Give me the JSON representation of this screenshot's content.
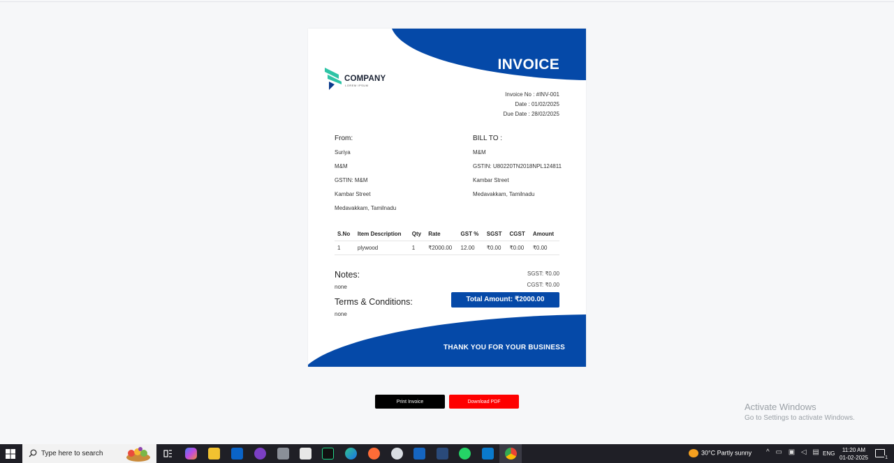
{
  "invoice": {
    "title": "INVOICE",
    "company_name": "COMPANY",
    "company_tagline": "LOREM IPSUM",
    "meta": {
      "invoice_no": "Invoice No : #INV-001",
      "date": "Date : 01/02/2025",
      "due_date": "Due Date : 28/02/2025"
    },
    "from": {
      "heading": "From:",
      "lines": [
        "Suriya",
        "M&M",
        "GSTIN: M&M",
        "Kambar Street",
        "Medavakkam, Tamilnadu"
      ]
    },
    "bill_to": {
      "heading": "BILL TO :",
      "lines": [
        "M&M",
        "GSTIN: U80220TN2018NPL124811",
        "Kambar Street",
        "Medavakkam, Tamilnadu"
      ]
    },
    "table": {
      "headers": [
        "S.No",
        "Item Description",
        "Qty",
        "Rate",
        "GST %",
        "SGST",
        "CGST",
        "Amount"
      ],
      "rows": [
        [
          "1",
          "plywood",
          "1",
          "₹2000.00",
          "12.00",
          "₹0.00",
          "₹0.00",
          "₹0.00"
        ]
      ]
    },
    "notes_heading": "Notes:",
    "notes_value": "none",
    "terms_heading": "Terms & Conditions:",
    "terms_value": "none",
    "sgst_total": "SGST: ₹0.00",
    "cgst_total": "CGST: ₹0.00",
    "total_amount": "Total Amount: ₹2000.00",
    "thanks": "THANK YOU FOR YOUR BUSINESS",
    "colors": {
      "brand_blue": "#0549a8",
      "logo_teal": "#2ec4a6",
      "logo_navy": "#0b3a8c"
    }
  },
  "actions": {
    "print_label": "Print Invoice",
    "download_label": "Download PDF",
    "print_color": "#000000",
    "download_color": "#fe0000"
  },
  "watermark": {
    "line1": "Activate Windows",
    "line2": "Go to Settings to activate Windows."
  },
  "taskbar": {
    "search_placeholder": "Type here to search",
    "weather": "30°C  Partly sunny",
    "tray_icons": [
      "chevron-up-icon",
      "network-icon",
      "battery-icon",
      "volume-icon",
      "keyboard-icon"
    ],
    "language": "ENG",
    "time": "11:20 AM",
    "date": "01-02-2025",
    "notification_count": "1",
    "apps": [
      "task-view-icon",
      "copilot-icon",
      "file-explorer-icon",
      "outlook-icon",
      "github-icon",
      "database-icon",
      "store-icon",
      "pycharm-icon",
      "edge-icon",
      "postman-icon",
      "cloud-app-icon",
      "c-app-icon",
      "code-blocks-icon",
      "whatsapp-icon",
      "vscode-icon",
      "chrome-icon"
    ]
  }
}
